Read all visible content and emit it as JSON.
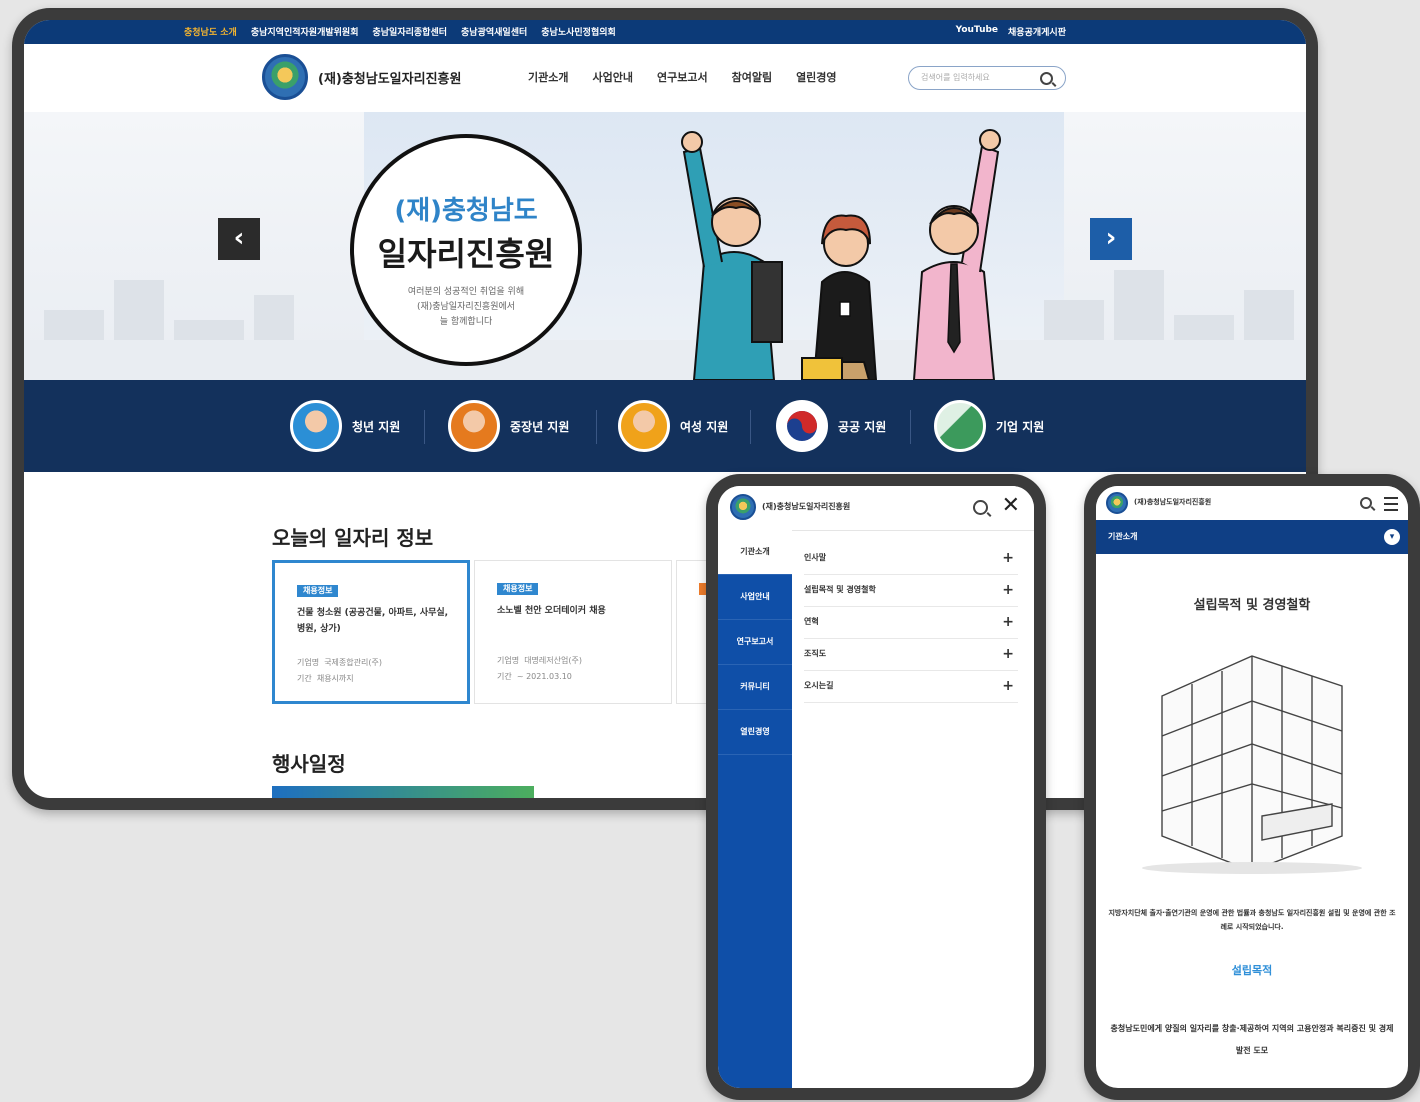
{
  "tablet": {
    "topbar_links": [
      "충청남도 소개",
      "충남지역인적자원개발위원회",
      "충남일자리종합센터",
      "충남광역새일센터",
      "충남노사민정협의회"
    ],
    "topbar_right": [
      "YouTube",
      "채용공개게시판"
    ],
    "org_name": "(재)충청남도일자리진흥원",
    "nav": [
      "기관소개",
      "사업안내",
      "연구보고서",
      "참여알림",
      "열린경영"
    ],
    "search_placeholder": "검색어를 입력하세요",
    "hero": {
      "line1": "(재)충청남도",
      "line2": "일자리진흥원",
      "line3": "여러분의 성공적인 취업을 위해",
      "line4": "(재)충남일자리진흥원에서",
      "line5": "늘 함께합니다"
    },
    "support_items": [
      {
        "label": "청년 지원",
        "color": "#2b8fd6"
      },
      {
        "label": "중장년 지원",
        "color": "#e57a1e"
      },
      {
        "label": "여성 지원",
        "color": "#f0a21a"
      },
      {
        "label": "공공 지원",
        "color": "#ffffff"
      },
      {
        "label": "기업 지원",
        "color": "#3c9a5c"
      }
    ],
    "today_jobs_title": "오늘의 일자리 정보",
    "job_cards": [
      {
        "tag": "채용정보",
        "title": "건물 청소원 (공공건물, 아파트, 사무실, 병원, 상가)",
        "company_label": "기업명",
        "company": "국제종합관리(주)",
        "period_label": "기간",
        "period": "채용시까지"
      },
      {
        "tag": "채용정보",
        "title": "소노벨 천안 오더테이커 채용",
        "company_label": "기업명",
        "company": "대명레저산업(주)",
        "period_label": "기간",
        "period": "~ 2021.03.10"
      }
    ],
    "events_title": "행사일정"
  },
  "phone1": {
    "org_name": "(재)충청남도일자리진흥원",
    "side_menu": [
      "기관소개",
      "사업안내",
      "연구보고서",
      "커뮤니티",
      "열린경영"
    ],
    "sub_menu": [
      "인사말",
      "설립목적 및 경영철학",
      "연혁",
      "조직도",
      "오시는길"
    ]
  },
  "phone2": {
    "org_name": "(재)충청남도일자리진흥원",
    "bar_label": "기관소개",
    "page_title": "설립목적 및 경영철학",
    "desc": "지방자치단체 출자·출연기관의 운영에 관한 법률과 충청남도 일자리진흥원 설립 및 운영에 관한 조례로 시작되었습니다.",
    "section_title": "설립목적",
    "section_desc": "충청남도민에게 양질의 일자리를 창출·제공하여 지역의 고용안정과 복리증진 및 경제발전 도모"
  },
  "colors": {
    "navy": "#13315c",
    "blue": "#0f4fa8",
    "accent": "#2f87cf"
  }
}
